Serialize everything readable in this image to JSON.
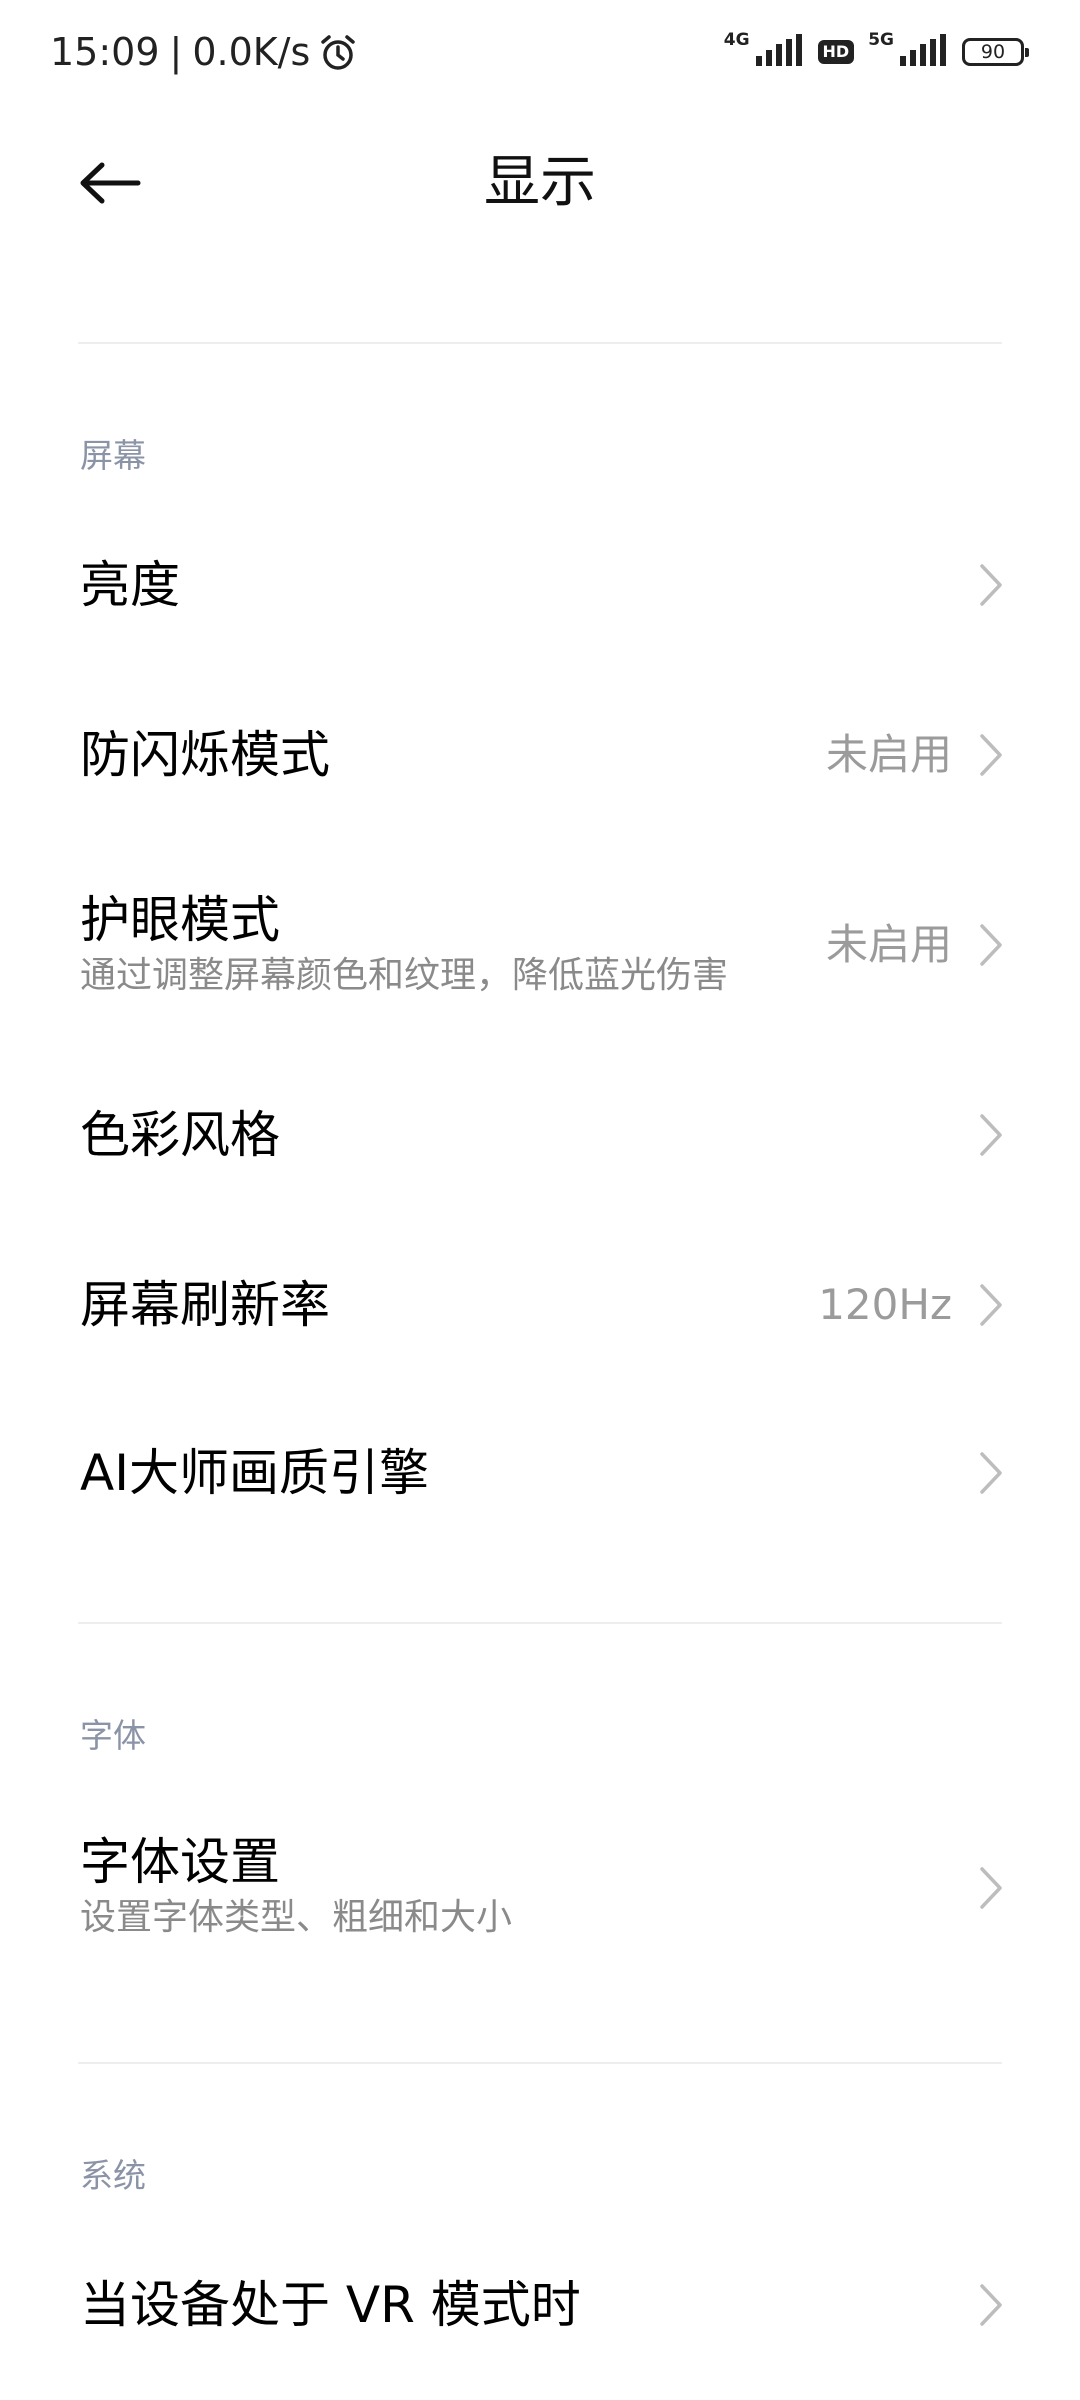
{
  "status_bar": {
    "time": "15:09",
    "separator": "|",
    "net_speed": "0.0K/s",
    "signal1_label": "4G",
    "hd_label": "HD",
    "signal2_label": "5G",
    "battery": "90",
    "icons": [
      "alarm-icon",
      "signal-icon",
      "signal-icon",
      "battery-icon"
    ]
  },
  "header": {
    "back_icon": "arrow-left-icon",
    "title": "显示"
  },
  "sections": {
    "screen": {
      "label": "屏幕",
      "brightness": {
        "title": "亮度"
      },
      "anti_flicker": {
        "title": "防闪烁模式",
        "value": "未启用"
      },
      "eye_care": {
        "title": "护眼模式",
        "subtitle": "通过调整屏幕颜色和纹理，降低蓝光伤害",
        "value": "未启用"
      },
      "color_style": {
        "title": "色彩风格"
      },
      "refresh_rate": {
        "title": "屏幕刷新率",
        "value": "120Hz"
      },
      "ai_engine": {
        "title": "AI大师画质引擎"
      }
    },
    "font": {
      "label": "字体",
      "font_settings": {
        "title": "字体设置",
        "subtitle": "设置字体类型、粗细和大小"
      }
    },
    "system": {
      "label": "系统",
      "vr_mode": {
        "title": "当设备处于 VR 模式时"
      }
    }
  },
  "colors": {
    "section_label": "#8b93a7",
    "secondary_text": "#8a8a8a",
    "value_text": "#9b9b9b",
    "divider": "#eeeeee"
  }
}
